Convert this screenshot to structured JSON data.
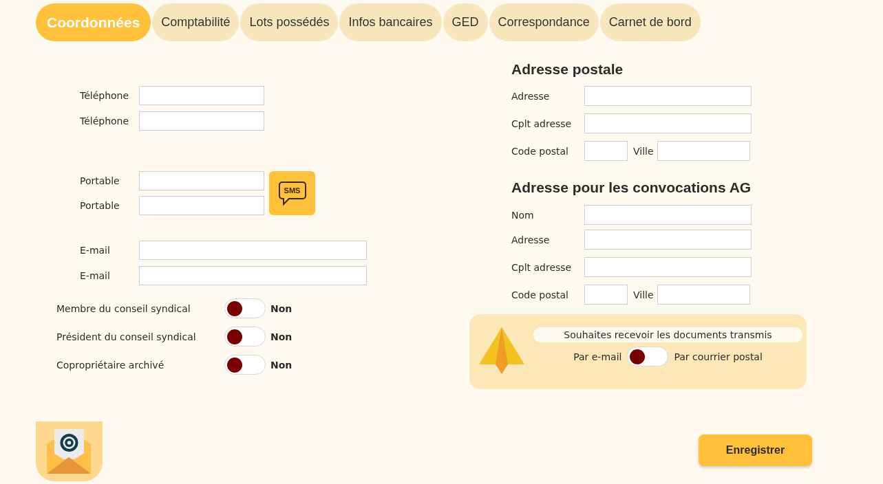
{
  "tabs": [
    {
      "label": "Coordonnées",
      "selected": true
    },
    {
      "label": "Comptabilité",
      "selected": false
    },
    {
      "label": "Lots possédés",
      "selected": false
    },
    {
      "label": "Infos bancaires",
      "selected": false
    },
    {
      "label": "GED",
      "selected": false
    },
    {
      "label": "Correspondance",
      "selected": false
    },
    {
      "label": "Carnet de bord",
      "selected": false
    }
  ],
  "phones": [
    {
      "label": "Téléphone"
    },
    {
      "label": "Téléphone"
    }
  ],
  "mobiles": [
    {
      "label": "Portable"
    },
    {
      "label": "Portable"
    }
  ],
  "sms_button": {
    "label": "SMS"
  },
  "emails": [
    {
      "label": "E-mail"
    },
    {
      "label": "E-mail"
    }
  ],
  "toggles": [
    {
      "label": "Membre du conseil syndical",
      "on": false,
      "state_text": "Non"
    },
    {
      "label": "Président du conseil syndical",
      "on": false,
      "state_text": "Non"
    },
    {
      "label": "Copropriétaire archivé",
      "on": false,
      "state_text": "Non"
    }
  ],
  "sections": [
    {
      "title": "Adresse postale",
      "fields": [
        {
          "kind": "single",
          "label": "Adresse"
        },
        {
          "kind": "single",
          "label": "Cplt adresse"
        },
        {
          "kind": "pair",
          "label": "Code postal",
          "second_label": "Ville"
        }
      ]
    },
    {
      "title": "Adresse pour les convocations AG",
      "fields": [
        {
          "kind": "single",
          "label": "Nom"
        },
        {
          "kind": "single",
          "label": "Adresse"
        },
        {
          "kind": "single",
          "label": "Cplt adresse"
        },
        {
          "kind": "pair",
          "label": "Code postal",
          "second_label": "Ville"
        }
      ]
    }
  ],
  "delivery": {
    "prompt": "Souhaites recevoir les documents transmis",
    "left_option": "Par e-mail",
    "right_option": "Par courrier postal",
    "by_post": false
  },
  "save_button": {
    "label": "Enregistrer"
  }
}
